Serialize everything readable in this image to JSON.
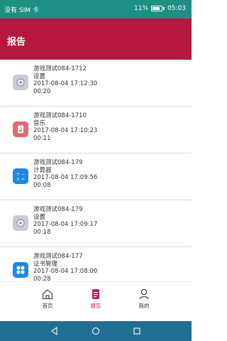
{
  "status_bar": {
    "carrier": "没有 SIM 卡",
    "battery": "11%",
    "time": "05:03"
  },
  "header": {
    "title": "报告"
  },
  "reports": [
    {
      "name": "游戏测试084-1712",
      "app": "设置",
      "datetime": "2017-08-04 17:12:30",
      "duration": "00:20",
      "icon": "settings-icon"
    },
    {
      "name": "游戏测试084-1710",
      "app": "音乐",
      "datetime": "2017-08-04 17:10:23",
      "duration": "00:11",
      "icon": "music-icon"
    },
    {
      "name": "游戏测试084-179",
      "app": "计算器",
      "datetime": "2017-08-04 17:09:56",
      "duration": "00:08",
      "icon": "calculator-icon"
    },
    {
      "name": "游戏测试084-179",
      "app": "设置",
      "datetime": "2017-08-04 17:09:17",
      "duration": "00:18",
      "icon": "settings-icon"
    },
    {
      "name": "游戏测试084-177",
      "app": "证书管理",
      "datetime": "2017-08-04 17:08:00",
      "duration": "00:28",
      "icon": "certificate-manager-icon"
    }
  ],
  "bottom_nav": {
    "home": "首页",
    "report": "报告",
    "mine": "我的"
  },
  "colors": {
    "header": "#b7183f",
    "active_tab": "#c2185b",
    "status_bar": "#1f8f84"
  }
}
